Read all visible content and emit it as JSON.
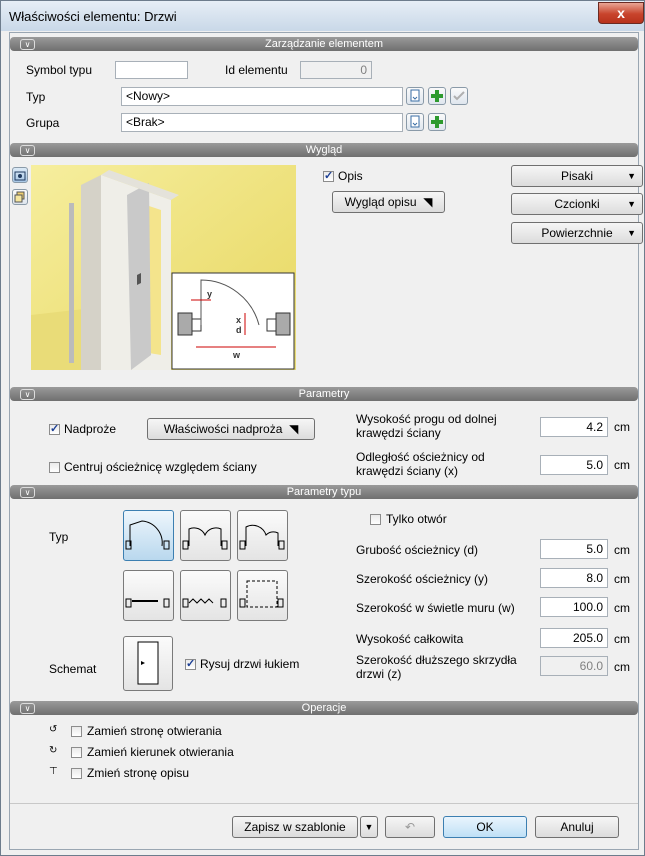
{
  "window": {
    "title": "Właściwości elementu: Drzwi",
    "close_symbol": "x"
  },
  "sections": {
    "management": "Zarządzanie elementem",
    "appearance": "Wygląd",
    "parameters": "Parametry",
    "type_parameters": "Parametry typu",
    "operations": "Operacje"
  },
  "management": {
    "symbol_label": "Symbol typu",
    "symbol_value": "",
    "id_label": "Id elementu",
    "id_value": "0",
    "type_label": "Typ",
    "type_value": "<Nowy>",
    "group_label": "Grupa",
    "group_value": "<Brak>"
  },
  "appearance": {
    "opis_label": "Opis",
    "opis_checked": true,
    "wyglad_opisu": "Wygląd opisu",
    "pisaki": "Pisaki",
    "czcionki": "Czcionki",
    "powierzchnie": "Powierzchnie",
    "dim_y": "y",
    "dim_x": "x",
    "dim_d": "d",
    "dim_w": "w"
  },
  "parameters": {
    "nadproze_label": "Nadproże",
    "nadproze_checked": true,
    "nadproze_btn": "Właściwości nadproża",
    "centruj_label": "Centruj ościeżnicę względem ściany",
    "centruj_checked": false,
    "prog_label": "Wysokość progu od dolnej krawędzi ściany",
    "prog_value": "4.2",
    "odleglosc_label": "Odległość ościeżnicy od krawędzi ściany (x)",
    "odleglosc_value": "5.0",
    "unit": "cm"
  },
  "type_parameters": {
    "typ_label": "Typ",
    "schemat_label": "Schemat",
    "rysuj_label": "Rysuj drzwi łukiem",
    "rysuj_checked": true,
    "tylko_otwor_label": "Tylko otwór",
    "tylko_otwor_checked": false,
    "rows": [
      {
        "label": "Grubość ościeżnicy (d)",
        "value": "5.0"
      },
      {
        "label": "Szerokość ościeżnicy (y)",
        "value": "8.0"
      },
      {
        "label": "Szerokość w świetle muru (w)",
        "value": "100.0"
      },
      {
        "label": "Wysokość całkowita",
        "value": "205.0"
      },
      {
        "label": "Szerokość dłuższego skrzydła drzwi (z)",
        "value": "60.0"
      }
    ],
    "unit": "cm"
  },
  "operations": {
    "items": [
      {
        "label": "Zamień stronę otwierania"
      },
      {
        "label": "Zamień kierunek otwierania"
      },
      {
        "label": "Zmień stronę opisu"
      }
    ]
  },
  "footer": {
    "save_template": "Zapisz w szablonie",
    "ok": "OK",
    "cancel": "Anuluj"
  }
}
